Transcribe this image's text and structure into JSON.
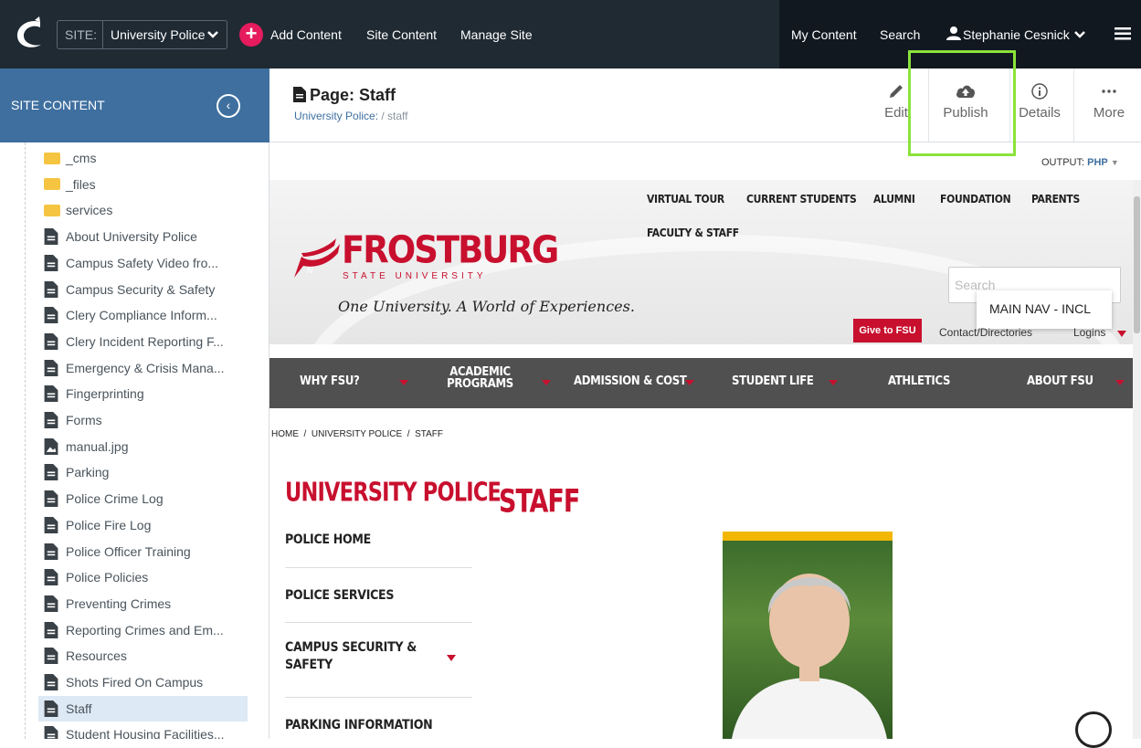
{
  "topbar": {
    "site_label": "SITE:",
    "site_value": "University Police",
    "add_content": "Add Content",
    "site_content": "Site Content",
    "manage_site": "Manage Site",
    "my_content": "My Content",
    "search": "Search",
    "user_name": "Stephanie Cesnick"
  },
  "sidebar": {
    "title": "SITE CONTENT",
    "items": [
      {
        "label": "_cms",
        "type": "folder"
      },
      {
        "label": "_files",
        "type": "folder"
      },
      {
        "label": "services",
        "type": "folder"
      },
      {
        "label": "About University Police",
        "type": "page"
      },
      {
        "label": "Campus Safety Video fro...",
        "type": "page"
      },
      {
        "label": "Campus Security & Safety",
        "type": "page"
      },
      {
        "label": "Clery Compliance Inform...",
        "type": "page"
      },
      {
        "label": "Clery Incident Reporting F...",
        "type": "page"
      },
      {
        "label": "Emergency & Crisis Mana...",
        "type": "page"
      },
      {
        "label": "Fingerprinting",
        "type": "page"
      },
      {
        "label": "Forms",
        "type": "page"
      },
      {
        "label": "manual.jpg",
        "type": "image"
      },
      {
        "label": "Parking",
        "type": "page"
      },
      {
        "label": "Police Crime Log",
        "type": "page"
      },
      {
        "label": "Police Fire Log",
        "type": "page"
      },
      {
        "label": "Police Officer Training",
        "type": "page"
      },
      {
        "label": "Police Policies",
        "type": "page"
      },
      {
        "label": "Preventing Crimes",
        "type": "page"
      },
      {
        "label": "Reporting Crimes and Em...",
        "type": "page"
      },
      {
        "label": "Resources",
        "type": "page"
      },
      {
        "label": "Shots Fired On Campus",
        "type": "page"
      },
      {
        "label": "Staff",
        "type": "page",
        "selected": true
      },
      {
        "label": "Student Housing Facilities...",
        "type": "page"
      }
    ]
  },
  "page": {
    "title": "Page: Staff",
    "crumb_site": "University Police:",
    "crumb_rest": "/ staff",
    "actions": {
      "edit": "Edit",
      "publish": "Publish",
      "details": "Details",
      "more": "More"
    },
    "output_label": "OUTPUT:",
    "output_value": "PHP"
  },
  "preview": {
    "utility_links": [
      "VIRTUAL TOUR",
      "CURRENT STUDENTS",
      "ALUMNI",
      "FOUNDATION",
      "PARENTS",
      "FACULTY & STAFF"
    ],
    "wordmark": "FROSTBURG",
    "wordmark_sub": "STATE UNIVERSITY",
    "tagline": "One University. A World of Experiences.",
    "search_placeholder": "Search",
    "tooltip": "MAIN NAV - INCL",
    "give_button": "Give to FSU",
    "contact": "Contact/Directories",
    "login": "Logins",
    "main_nav": [
      "WHY FSU?",
      "ACADEMIC PROGRAMS",
      "ADMISSION & COST",
      "STUDENT LIFE",
      "ATHLETICS",
      "ABOUT FSU"
    ],
    "breadcrumb": "HOME  /  UNIVERSITY POLICE  /  STAFF",
    "section_title": "UNIVERSITY POLICE",
    "page_heading": "STAFF",
    "left_nav": [
      "POLICE HOME",
      "POLICE SERVICES",
      "CAMPUS SECURITY & SAFETY",
      "PARKING INFORMATION"
    ]
  },
  "colors": {
    "topbar": "#1f2a33",
    "sidebar_header": "#3e6f9f",
    "fsu_red": "#c8102e",
    "publish_highlight": "#8be33a",
    "nav_gray": "#505050"
  }
}
